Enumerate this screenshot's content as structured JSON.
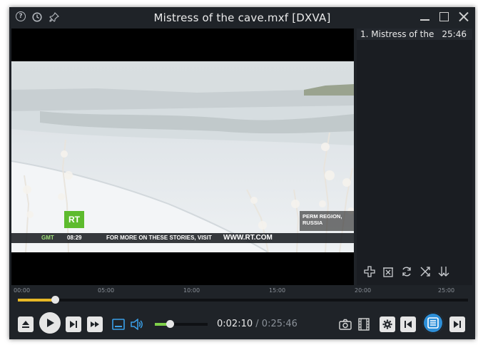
{
  "window": {
    "title": "Mistress of the cave.mxf [DXVA]",
    "icons": [
      "help-icon",
      "clock-icon",
      "pin-icon"
    ],
    "buttons": [
      "minimize-icon",
      "maximize-icon",
      "close-icon"
    ]
  },
  "video": {
    "overlay": {
      "logo": "RT",
      "gmt_label": "GMT",
      "gmt_time": "08:29",
      "ticker_message": "FOR MORE ON THESE STORIES, VISIT",
      "ticker_url": "WWW.RT.COM",
      "region_line1": "PERM REGION,",
      "region_line2": "RUSSIA"
    }
  },
  "playlist": {
    "items": [
      {
        "label": "1. Mistress of the",
        "duration": "25:46"
      }
    ],
    "tools": [
      "add-icon",
      "remove-icon",
      "refresh-icon",
      "shuffle-icon",
      "sort-icon"
    ]
  },
  "timeline": {
    "ticks": [
      "00:00",
      "05:00",
      "10:00",
      "15:00",
      "20:00",
      "25:00"
    ],
    "position_fraction": 0.0841
  },
  "controls": {
    "current_time": "0:02:10",
    "separator": "/",
    "total_time": "0:25:46",
    "volume_fraction": 0.28,
    "colors": {
      "seek": "#e7b826",
      "volume": "#7fd04a",
      "accent": "#2d8fd8"
    }
  }
}
